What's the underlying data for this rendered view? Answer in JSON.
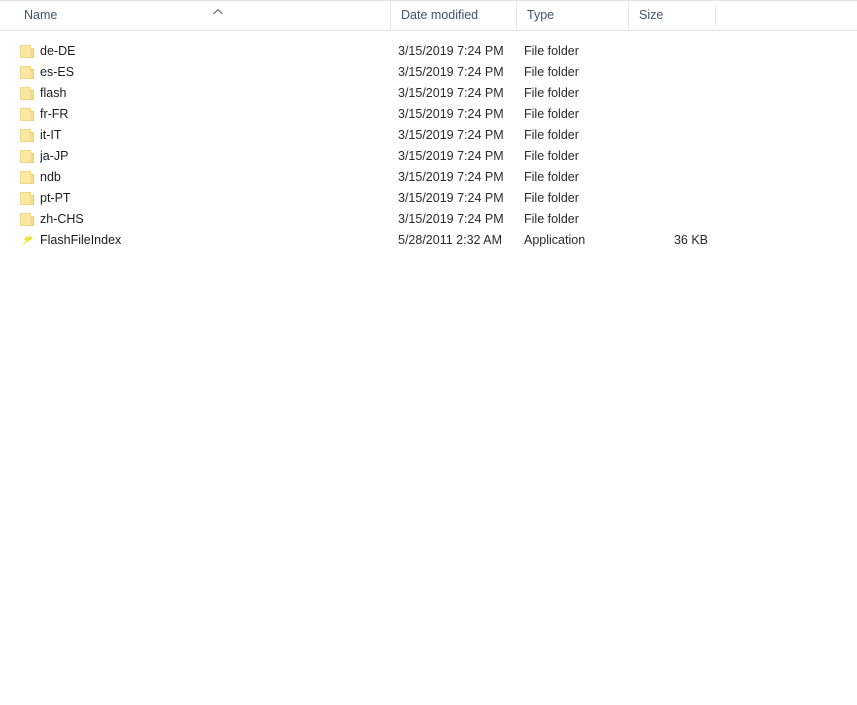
{
  "window": {
    "view": "details"
  },
  "columns": {
    "name": {
      "label": "Name",
      "sort": "ascending",
      "sort_icon": "chevron-up-icon"
    },
    "date_modified": {
      "label": "Date modified"
    },
    "type": {
      "label": "Type"
    },
    "size": {
      "label": "Size"
    }
  },
  "rows": [
    {
      "name": "de-DE",
      "date_modified": "3/15/2019 7:24 PM",
      "type": "File folder",
      "size": "",
      "icon": "folder-icon"
    },
    {
      "name": "es-ES",
      "date_modified": "3/15/2019 7:24 PM",
      "type": "File folder",
      "size": "",
      "icon": "folder-icon"
    },
    {
      "name": "flash",
      "date_modified": "3/15/2019 7:24 PM",
      "type": "File folder",
      "size": "",
      "icon": "folder-icon"
    },
    {
      "name": "fr-FR",
      "date_modified": "3/15/2019 7:24 PM",
      "type": "File folder",
      "size": "",
      "icon": "folder-icon"
    },
    {
      "name": "it-IT",
      "date_modified": "3/15/2019 7:24 PM",
      "type": "File folder",
      "size": "",
      "icon": "folder-icon"
    },
    {
      "name": "ja-JP",
      "date_modified": "3/15/2019 7:24 PM",
      "type": "File folder",
      "size": "",
      "icon": "folder-icon"
    },
    {
      "name": "ndb",
      "date_modified": "3/15/2019 7:24 PM",
      "type": "File folder",
      "size": "",
      "icon": "folder-icon"
    },
    {
      "name": "pt-PT",
      "date_modified": "3/15/2019 7:24 PM",
      "type": "File folder",
      "size": "",
      "icon": "folder-icon"
    },
    {
      "name": "zh-CHS",
      "date_modified": "3/15/2019 7:24 PM",
      "type": "File folder",
      "size": "",
      "icon": "folder-icon"
    },
    {
      "name": "FlashFileIndex",
      "date_modified": "5/28/2011 2:32 AM",
      "type": "Application",
      "size": "36 KB",
      "icon": "flash-application-icon"
    }
  ],
  "colors": {
    "header_text": "#44546d",
    "row_text": "#1c1c1c",
    "folder_fill": "#fbe7a2",
    "app_icon_background": "#0a0a0a",
    "app_icon_bolt": "#f2e520",
    "divider": "#e7e7e7",
    "background": "#ffffff"
  }
}
